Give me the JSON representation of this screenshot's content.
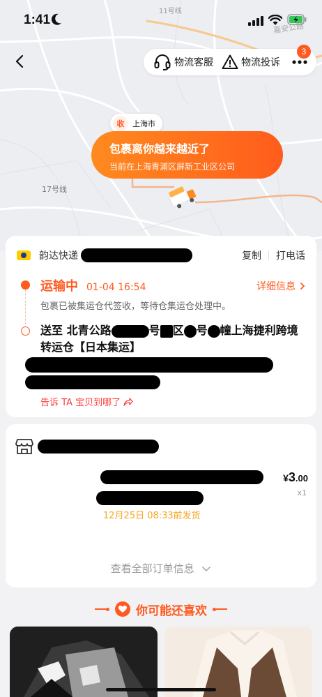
{
  "status_bar": {
    "time": "1:41"
  },
  "map": {
    "label_line17": "17号线",
    "label_line11": "11号线",
    "label_road": "嘉安公路",
    "pin_receive": "收",
    "pin_city": "上海市",
    "bubble_title": "包裹离你越来越近了",
    "bubble_sub": "当前在上海青浦区屏新工业区公司"
  },
  "top_actions": {
    "service_label": "物流客服",
    "complain_label": "物流投诉",
    "badge_count": "3"
  },
  "logistics": {
    "carrier": "韵达快递",
    "copy_label": "复制",
    "call_label": "打电话",
    "status_title": "运输中",
    "status_time": "01-04 16:54",
    "detail_label": "详细信息",
    "status_desc": "包裹已被集运仓代签收，等待仓集运仓处理中。",
    "dest_prefix": "送至 北青公路",
    "dest_part1": "号",
    "dest_part2": "区",
    "dest_part3": "号",
    "dest_part4": "幢上海捷利跨境转运仓【日本集运】",
    "tell_label": "告诉 TA 宝贝到哪了"
  },
  "order": {
    "price_currency": "¥",
    "price_int": "3",
    "price_dec": ".00",
    "quantity": "x1",
    "ship_time": "12月25日 08:33前发货",
    "view_all": "查看全部订单信息"
  },
  "recommend": {
    "title": "你可能还喜欢"
  },
  "colors": {
    "accent": "#ff5a1f",
    "ship_time": "#f5a623",
    "tell": "#ff3b3b"
  },
  "icons": [
    "moon-icon",
    "signal-icon",
    "wifi-icon",
    "battery-icon",
    "back-icon",
    "headset-icon",
    "warning-icon",
    "more-icon",
    "truck-icon",
    "carrier-logo-icon",
    "chevron-right-icon",
    "share-icon",
    "shop-icon",
    "chevron-down-icon",
    "heart-icon"
  ]
}
